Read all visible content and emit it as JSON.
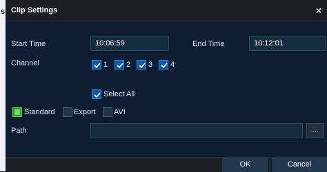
{
  "window": {
    "title": "Clip Settings",
    "close_glyph": "×",
    "left_edge_glyph": "s"
  },
  "form": {
    "start_time_label": "Start Time",
    "start_time_value": "10:06:59",
    "end_time_label": "End Time",
    "end_time_value": "10:12:01",
    "channel_label": "Channel",
    "channels": [
      {
        "label": "1",
        "checked": true
      },
      {
        "label": "2",
        "checked": true
      },
      {
        "label": "3",
        "checked": true
      },
      {
        "label": "4",
        "checked": true
      }
    ],
    "select_all_label": "Select All",
    "select_all_checked": true,
    "modes": [
      {
        "label": "Standard",
        "selected": true
      },
      {
        "label": "Export",
        "selected": false
      },
      {
        "label": "AVI",
        "selected": false
      }
    ],
    "path_label": "Path",
    "path_value": "",
    "browse_label": "..."
  },
  "buttons": {
    "ok": "OK",
    "cancel": "Cancel"
  },
  "colors": {
    "accent_check": "#0d5aa4",
    "mode_selected": "#2e9a39",
    "dialog_bg": "#0e1d33"
  },
  "icons": {
    "check": "check-icon",
    "close": "close-icon"
  }
}
